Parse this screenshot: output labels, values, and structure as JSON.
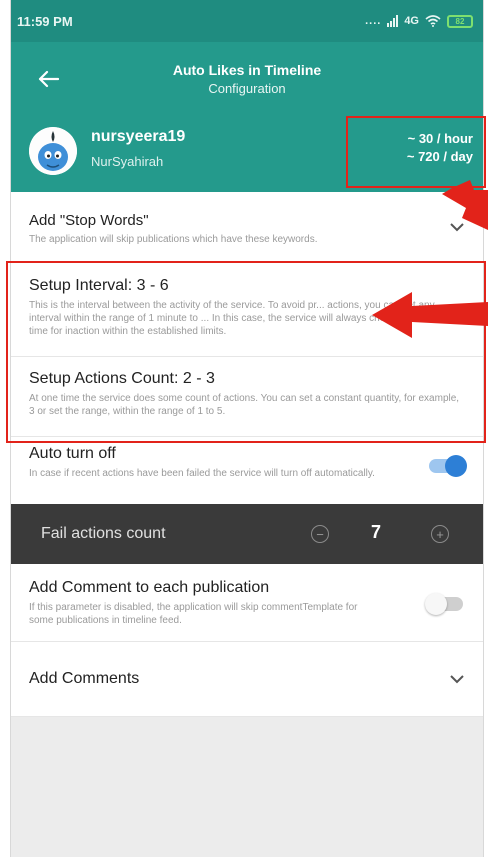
{
  "status_bar": {
    "time": "11:59 PM",
    "network": "4G",
    "battery": "82"
  },
  "app_bar": {
    "title": "Auto Likes in Timeline",
    "subtitle": "Configuration"
  },
  "profile": {
    "username": "nursyeera19",
    "display_name": "NurSyahirah",
    "rate_hour": "~ 30 / hour",
    "rate_day": "~ 720 / day"
  },
  "settings": {
    "stop_words": {
      "title": "Add \"Stop Words\"",
      "desc": "The application will skip publications which have these keywords."
    },
    "interval": {
      "title": "Setup Interval: 3 - 6",
      "desc": "This is the interval between the activity of the service. To avoid pr... actions, you can set any interval within the range of 1 minute to ... In this case, the service will always choose a random time for inaction within the established limits."
    },
    "actions_count": {
      "title": "Setup Actions Count: 2 - 3",
      "desc": "At one time the service does some count of actions. You can set a constant quantity, for example, 3 or set the range, within the range of 1 to 5."
    },
    "auto_turn_off": {
      "title": "Auto turn off",
      "desc": "In case if recent actions have been failed the service will turn off automatically.",
      "enabled": true
    },
    "fail_actions": {
      "label": "Fail actions count",
      "value": "7",
      "minus": "−",
      "plus": "+"
    },
    "add_comment": {
      "title": "Add Comment to each publication",
      "desc": "If this parameter is disabled, the application will skip commentTemplate for some publications in timeline feed.",
      "enabled": false
    },
    "add_comments": {
      "title": "Add Comments"
    }
  },
  "colors": {
    "status_bar": "#1f8c80",
    "app_bar": "#249a8c",
    "toggle_on": "#2d7fd6",
    "highlight": "#e2231a",
    "dark_row": "#3a3a3a"
  }
}
